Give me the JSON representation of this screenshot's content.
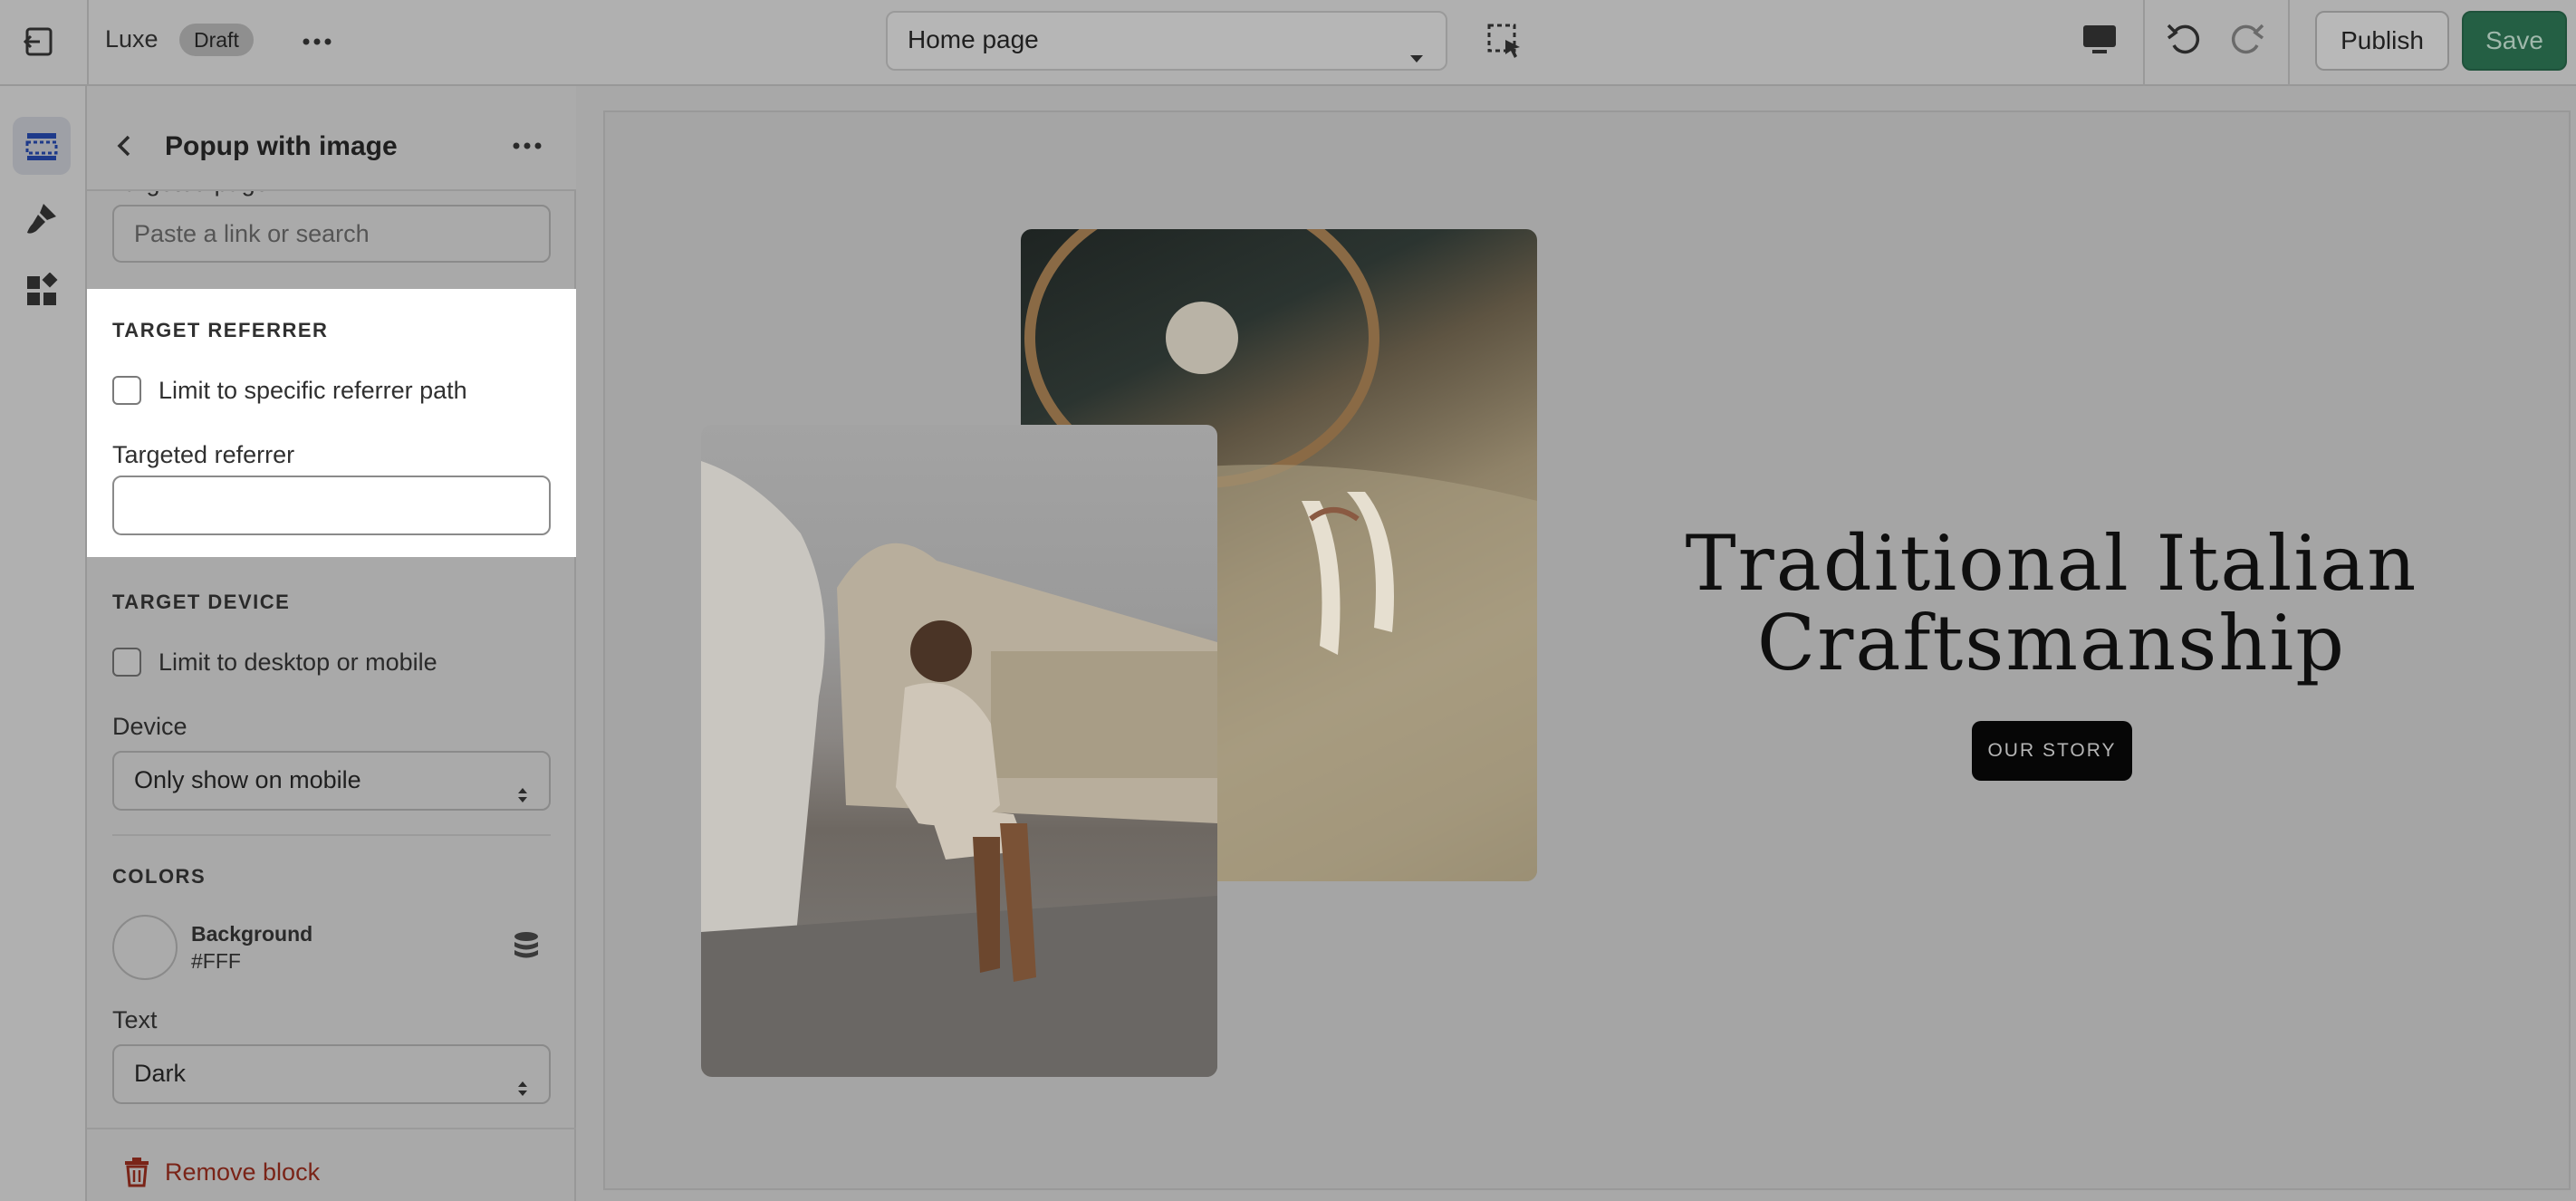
{
  "topbar": {
    "store_name": "Luxe",
    "status_badge": "Draft",
    "page_select": "Home page",
    "publish_label": "Publish",
    "save_label": "Save"
  },
  "panel": {
    "title": "Popup with image",
    "partial_label": "Targeted page",
    "targeted_page_placeholder": "Paste a link or search",
    "target_referrer": {
      "heading": "TARGET REFERRER",
      "checkbox_label": "Limit to specific referrer path",
      "field_label": "Targeted referrer",
      "field_value": ""
    },
    "target_device": {
      "heading": "TARGET DEVICE",
      "checkbox_label": "Limit to desktop or mobile",
      "device_label": "Device",
      "device_value": "Only show on mobile"
    },
    "colors": {
      "heading": "COLORS",
      "background_label": "Background",
      "background_value": "#FFF",
      "text_label": "Text",
      "text_value": "Dark"
    },
    "remove_label": "Remove block"
  },
  "preview": {
    "headline_line1": "Traditional Italian",
    "headline_line2": "Craftsmanship",
    "cta_label": "OUR STORY"
  },
  "colors": {
    "accent_save": "#245f44",
    "remove_red": "#7a2418",
    "highlight_bg": "#ffffff"
  }
}
